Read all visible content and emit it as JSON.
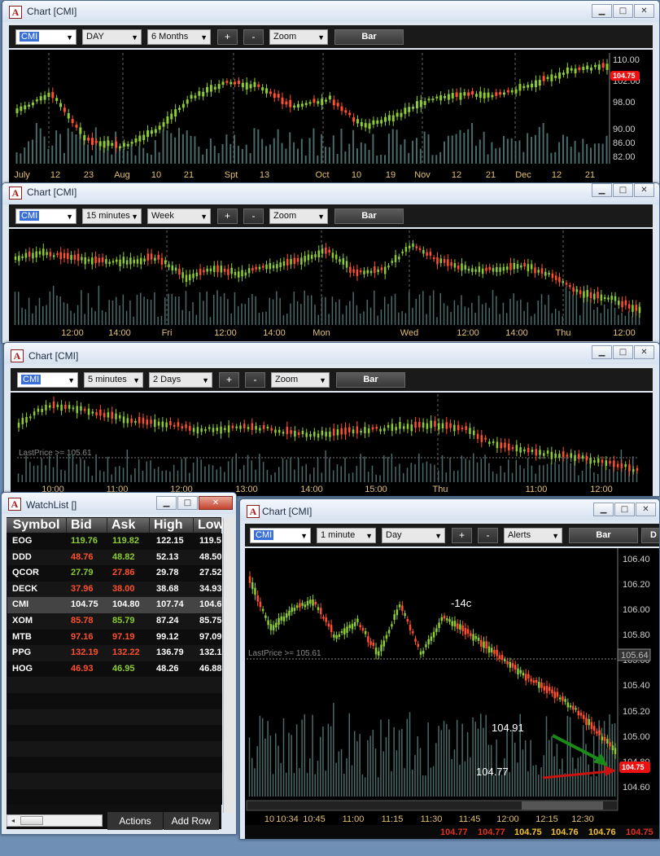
{
  "chart1": {
    "title": "Chart [CMI]",
    "symbol": "CMI",
    "interval": "DAY",
    "range": "6 Months",
    "plus": "+",
    "minus": "-",
    "zoom": "Zoom",
    "style": "Bar",
    "y_ticks": [
      "110.00",
      "106.00",
      "102.00",
      "98.00",
      "90.00",
      "86.00",
      "82.00"
    ],
    "price_tag": "104.75",
    "x_labels": [
      "July",
      "12",
      "23",
      "Aug",
      "10",
      "21",
      "Spt",
      "13",
      "Oct",
      "10",
      "19",
      "Nov",
      "12",
      "21",
      "Dec",
      "12",
      "21"
    ]
  },
  "chart2": {
    "title": "Chart [CMI]",
    "symbol": "CMI",
    "interval": "15 minutes",
    "range": "Week",
    "plus": "+",
    "minus": "-",
    "zoom": "Zoom",
    "style": "Bar",
    "x_labels": [
      "12:00",
      "14:00",
      "Fri",
      "12:00",
      "14:00",
      "Mon",
      "Wed",
      "12:00",
      "14:00",
      "Thu",
      "12:00"
    ]
  },
  "chart3": {
    "title": "Chart [CMI]",
    "symbol": "CMI",
    "interval": "5 minutes",
    "range": "2 Days",
    "plus": "+",
    "minus": "-",
    "zoom": "Zoom",
    "style": "Bar",
    "last_price": "LastPrice >= 105.61",
    "x_labels": [
      "10:00",
      "11:00",
      "12:00",
      "13:00",
      "14:00",
      "15:00",
      "Thu",
      "11:00",
      "12:00"
    ]
  },
  "chart4": {
    "title": "Chart [CMI]",
    "symbol": "CMI",
    "interval": "1 minute",
    "range": "Day",
    "plus": "+",
    "minus": "-",
    "alerts": "Alerts",
    "style": "Bar",
    "extra": "D",
    "y_ticks": [
      "106.40",
      "106.20",
      "106.00",
      "105.80",
      "105.60",
      "105.40",
      "105.20",
      "105.00",
      "104.80",
      "104.60"
    ],
    "last_price": "LastPrice >= 105.61",
    "last_tag": "105.64",
    "price_tag": "104.75",
    "annotations": {
      "change": "-14c",
      "high_mark": "104.91",
      "low_mark": "104.77"
    },
    "x_labels": [
      "10",
      "10:34",
      "10:45",
      "11:00",
      "11:15",
      "11:30",
      "11:45",
      "12:00",
      "12:15",
      "12:30"
    ],
    "bottom_prices": [
      {
        "v": "104.77",
        "c": "r"
      },
      {
        "v": "104.77",
        "c": "r"
      },
      {
        "v": "104.75",
        "c": "y"
      },
      {
        "v": "104.76",
        "c": "y"
      },
      {
        "v": "104.76",
        "c": "y"
      },
      {
        "v": "104.75",
        "c": "r"
      }
    ]
  },
  "watchlist": {
    "title": "WatchList []",
    "columns": [
      "Symbol",
      "Bid",
      "Ask",
      "High",
      "Low"
    ],
    "rows": [
      {
        "sym": "EOG",
        "bid": "119.76",
        "ask": "119.82",
        "high": "122.15",
        "low": "119.5",
        "c": "g"
      },
      {
        "sym": "DDD",
        "bid": "48.76",
        "ask": "48.82",
        "high": "52.13",
        "low": "48.50",
        "c": "rg"
      },
      {
        "sym": "QCOR",
        "bid": "27.79",
        "ask": "27.86",
        "high": "29.78",
        "low": "27.52",
        "c": "gr"
      },
      {
        "sym": "DECK",
        "bid": "37.96",
        "ask": "38.00",
        "high": "38.68",
        "low": "34.93",
        "c": "r"
      },
      {
        "sym": "CMI",
        "bid": "104.75",
        "ask": "104.80",
        "high": "107.74",
        "low": "104.6",
        "c": "w"
      },
      {
        "sym": "XOM",
        "bid": "85.78",
        "ask": "85.79",
        "high": "87.24",
        "low": "85.75",
        "c": "rg"
      },
      {
        "sym": "MTB",
        "bid": "97.16",
        "ask": "97.19",
        "high": "99.12",
        "low": "97.09",
        "c": "r"
      },
      {
        "sym": "PPG",
        "bid": "132.19",
        "ask": "132.22",
        "high": "136.79",
        "low": "132.1",
        "c": "r"
      },
      {
        "sym": "HOG",
        "bid": "46.93",
        "ask": "46.95",
        "high": "48.26",
        "low": "46.88",
        "c": "rg"
      }
    ],
    "actions": "Actions",
    "add_row": "Add Row"
  },
  "colors": {
    "up": "#8ccc32",
    "down": "#ff4f2d",
    "volume": "#4a6a6a",
    "axis_text": "#e0c070"
  }
}
